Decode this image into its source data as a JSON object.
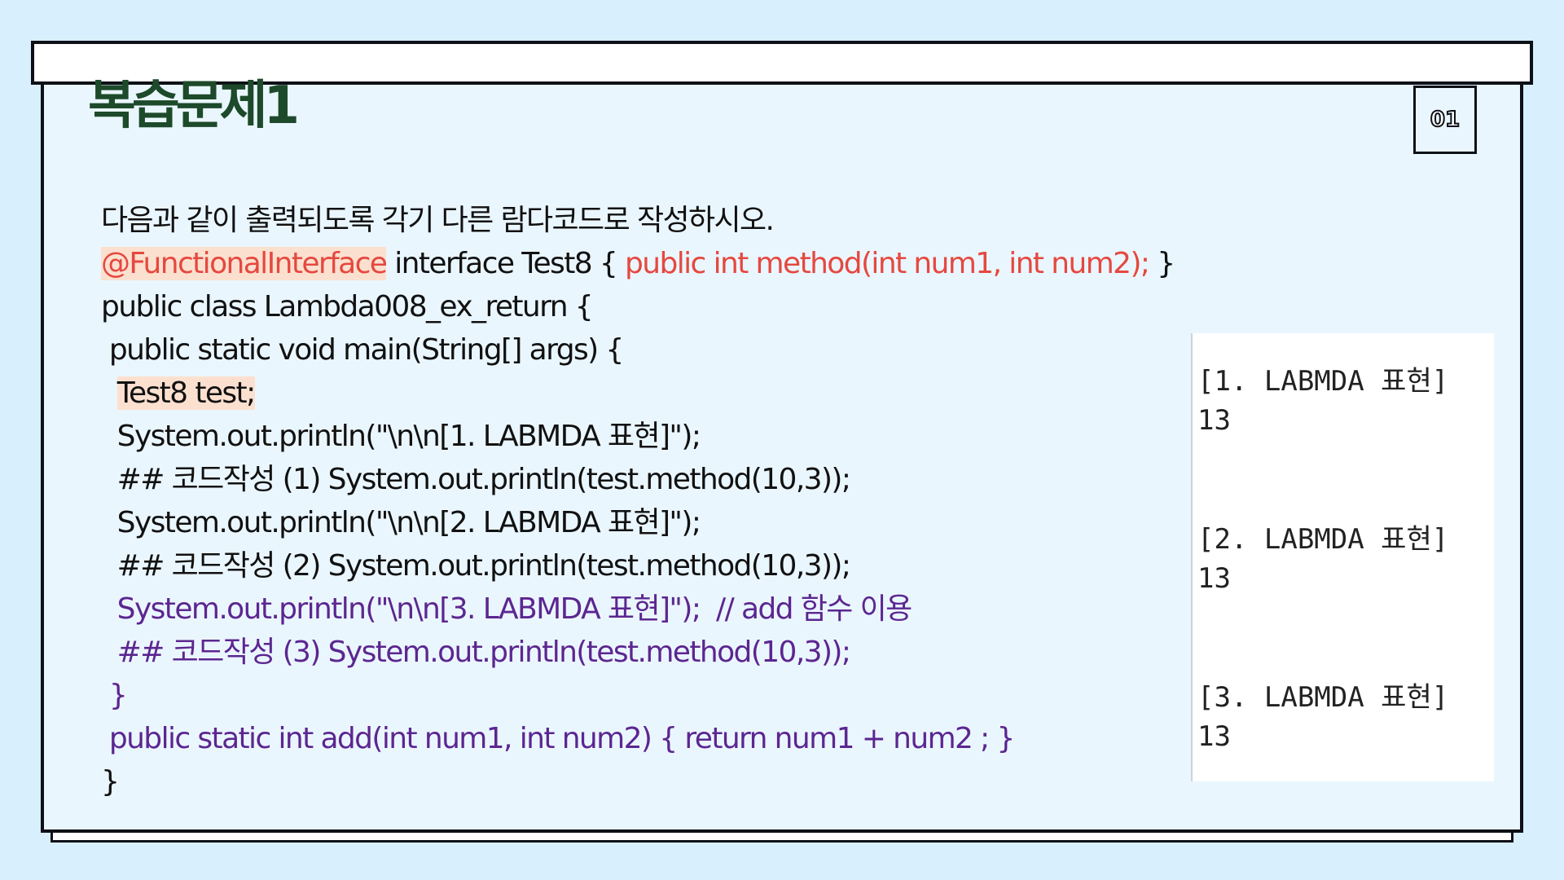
{
  "slide": {
    "title": "복습문제1",
    "page_number": "01"
  },
  "code": {
    "instruction": "다음과 같이 출력되도록 각기 다른 람다코드로 작성하시오.",
    "line2": {
      "annotation": "@FunctionalInterface",
      "middle": " interface Test8 { ",
      "signature": "public int method(int num1, int num2);",
      "end": " }"
    },
    "line3": "public class Lambda008_ex_return {",
    "line4": " public static void main(String[] args) {",
    "line5": {
      "indent": "  ",
      "decl": "Test8 test;"
    },
    "line6": "  System.out.println(\"\\n\\n[1. LABMDA 표현]\");",
    "line7": "  ## 코드작성 (1) System.out.println(test.method(10,3));",
    "line8": "  System.out.println(\"\\n\\n[2. LABMDA 표현]\");",
    "line9": "  ## 코드작성 (2) System.out.println(test.method(10,3));",
    "line10": "  System.out.println(\"\\n\\n[3. LABMDA 표현]\");  // add 함수 이용",
    "line11": "  ## 코드작성 (3) System.out.println(test.method(10,3));",
    "line12": " }",
    "line13": " public static int add(int num1, int num2) { return num1 + num2 ; }",
    "line14": "}"
  },
  "output": [
    {
      "header": "[1. LABMDA 표현]",
      "value": "13"
    },
    {
      "header": "[2. LABMDA 표현]",
      "value": "13"
    },
    {
      "header": "[3. LABMDA 표현]",
      "value": "13"
    }
  ],
  "colors": {
    "background": "#d8effe",
    "panel": "#eaf6fe",
    "title": "#1d4a2a",
    "keyword_red": "#e5483f",
    "purple": "#5c2690",
    "highlight": "#fce0cf"
  }
}
